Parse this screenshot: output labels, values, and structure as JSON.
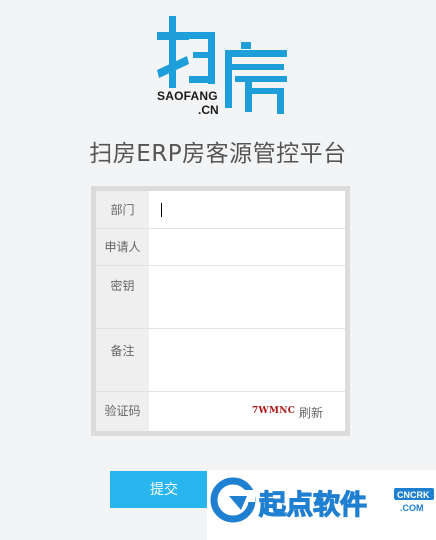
{
  "logo": {
    "line1": "SAOFANG",
    "line2": ".CN"
  },
  "title": "扫房ERP房客源管控平台",
  "form": {
    "department_label": "部门",
    "department_value": "",
    "applicant_label": "申请人",
    "applicant_value": "",
    "key_label": "密钥",
    "key_value": "",
    "note_label": "备注",
    "note_value": "",
    "captcha_label": "验证码",
    "captcha_value": "",
    "captcha_code": "7WMNC",
    "refresh_label": "刷新"
  },
  "submit_label": "提交",
  "watermark": {
    "text": "起点软件",
    "badge1": "CNCRK",
    "badge2": ".COM"
  },
  "colors": {
    "accent": "#29b6ef",
    "logo_blue": "#1f9fd9",
    "captcha_red": "#b01818"
  }
}
